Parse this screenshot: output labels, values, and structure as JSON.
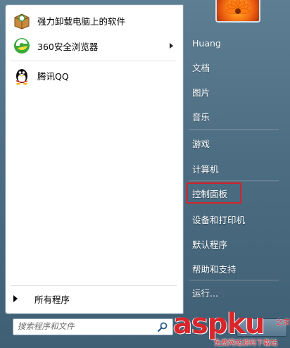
{
  "left_pane": {
    "programs": [
      {
        "label": "强力卸载电脑上的软件",
        "icon": "box-uninstall-icon"
      },
      {
        "label": "360安全浏览器",
        "icon": "360-browser-icon",
        "has_submenu": true
      },
      {
        "label": "腾讯QQ",
        "icon": "qq-penguin-icon"
      }
    ],
    "all_programs_label": "所有程序"
  },
  "search": {
    "placeholder": "搜索程序和文件",
    "icon": "search-icon"
  },
  "right_pane": {
    "items": [
      {
        "label": "Huang"
      },
      {
        "label": "文档"
      },
      {
        "label": "图片"
      },
      {
        "label": "音乐"
      },
      {
        "label": "游戏"
      },
      {
        "label": "计算机"
      },
      {
        "label": "控制面板",
        "highlighted": true
      },
      {
        "label": "设备和打印机"
      },
      {
        "label": "默认程序"
      },
      {
        "label": "帮助和支持"
      },
      {
        "label": "运行..."
      }
    ]
  },
  "watermark": {
    "main": "aspku",
    "suffix": "之家",
    "sub": "免费网站源码下载站"
  },
  "colors": {
    "highlight_box": "#d2232a",
    "right_pane_bg": "#4c6d82"
  }
}
